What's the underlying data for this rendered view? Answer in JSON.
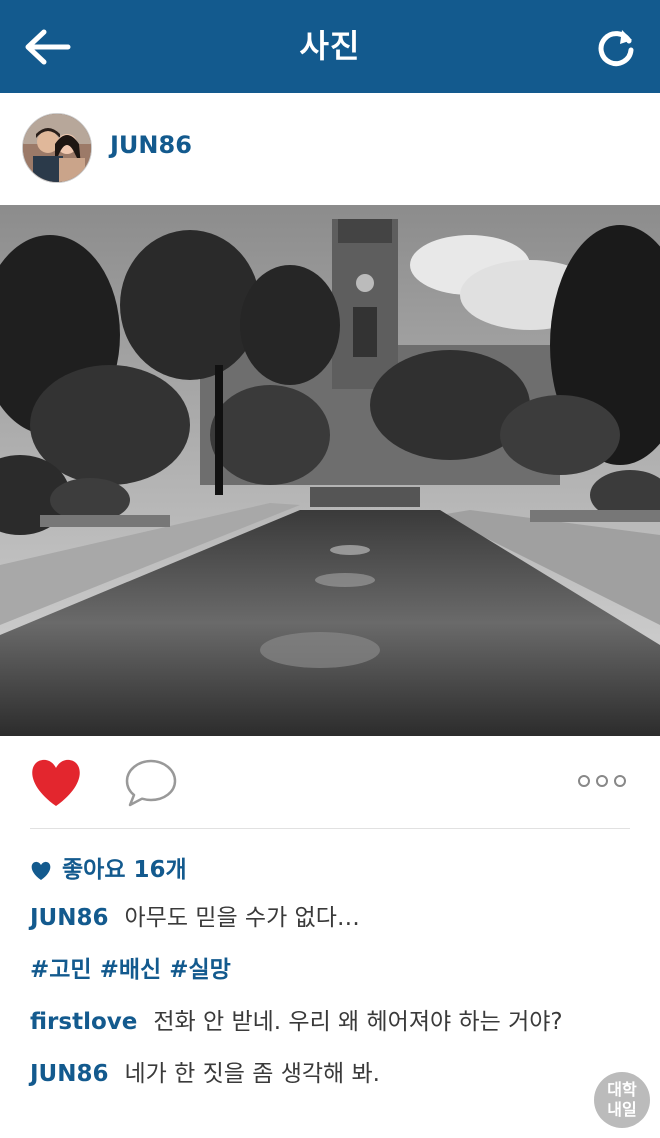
{
  "header": {
    "title": "사진",
    "bg_color": "#135a8e",
    "back_icon": "back-arrow-icon",
    "refresh_icon": "refresh-icon"
  },
  "post": {
    "username": "JUN86",
    "likes_label": "좋아요 16개",
    "liked": true,
    "heart_color": "#e3262e",
    "caption": {
      "user": "JUN86",
      "text": "아무도 믿을 수가 없다…"
    },
    "hashtags": [
      "#고민",
      "#배신",
      "#실망"
    ],
    "comments": [
      {
        "user": "firstlove",
        "text": "전화 안 받네. 우리 왜 헤어져야 하는 거야?"
      },
      {
        "user": "JUN86",
        "text": "네가 한 짓을 좀 생각해 봐."
      }
    ]
  },
  "watermark": {
    "line1": "대학",
    "line2": "내일"
  }
}
